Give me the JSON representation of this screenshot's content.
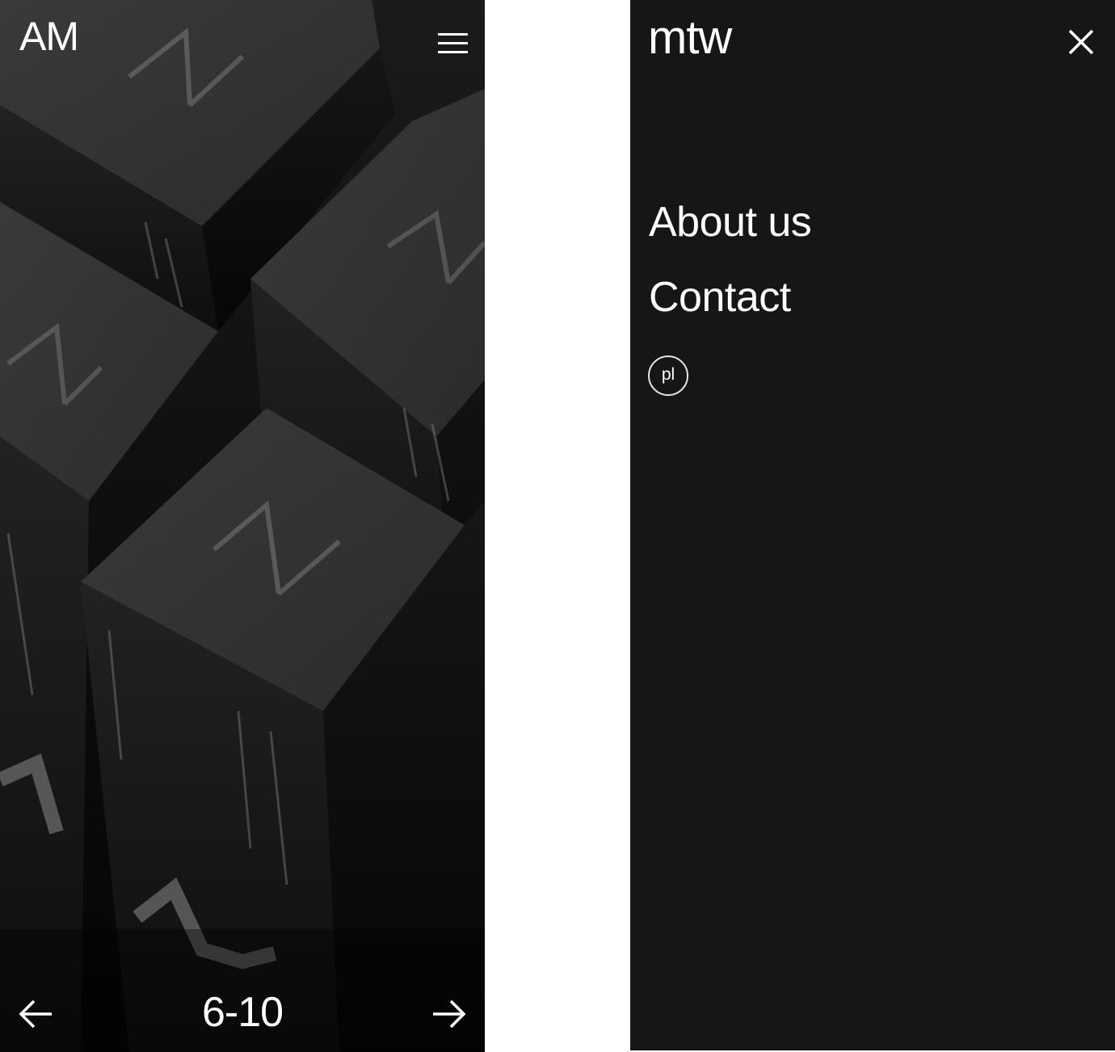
{
  "gallery_screen": {
    "brand_logo": "AM",
    "menu_icon": "hamburger-menu-icon",
    "prev_icon": "arrow-left-icon",
    "next_icon": "arrow-right-icon",
    "slide_counter": "6-10"
  },
  "menu_screen": {
    "logo": "mtw",
    "close_icon": "close-icon",
    "nav_items": [
      {
        "label": "About us"
      },
      {
        "label": "Contact"
      }
    ],
    "language_toggle": "pl"
  },
  "colors": {
    "menu_background": "#161616",
    "gallery_background": "#0c0c0c",
    "text": "#ffffff"
  }
}
